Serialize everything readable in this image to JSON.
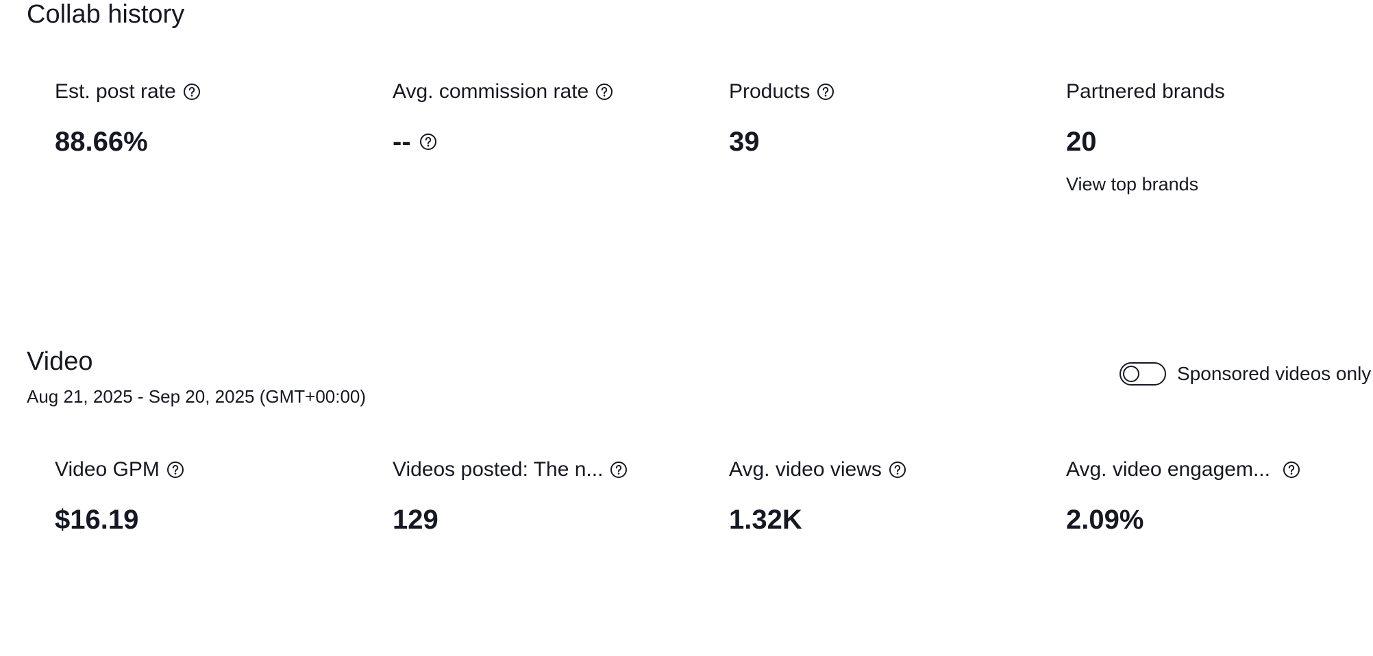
{
  "collab": {
    "title": "Collab history",
    "metrics": [
      {
        "label": "Est. post rate",
        "value": "88.66%"
      },
      {
        "label": "Avg. commission rate",
        "value": "--"
      },
      {
        "label": "Products",
        "value": "39"
      },
      {
        "label": "Partnered brands",
        "value": "20",
        "link": "View top brands"
      }
    ]
  },
  "video": {
    "title": "Video",
    "date_range": "Aug 21, 2025 - Sep 20, 2025 (GMT+00:00)",
    "toggle": {
      "label": "Sponsored videos only",
      "on": false
    },
    "metrics": [
      {
        "label": "Video GPM",
        "value": "$16.19"
      },
      {
        "label": "Videos posted: The n...",
        "value": "129"
      },
      {
        "label": "Avg. video views",
        "value": "1.32K"
      },
      {
        "label": "Avg. video engagem...",
        "value": "2.09%"
      }
    ]
  },
  "icons": {
    "help": "question-circle-icon"
  },
  "colors": {
    "text": "#161823",
    "background": "#ffffff"
  }
}
